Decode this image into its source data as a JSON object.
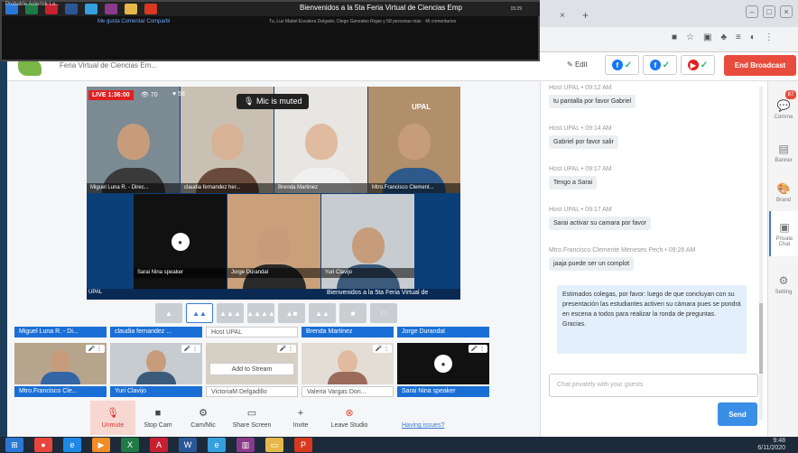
{
  "browser": {
    "tab_close": "×",
    "tab_new": "+",
    "win_controls": [
      "–",
      "□",
      "×"
    ],
    "addr_icons": [
      "■",
      "☆",
      "▣",
      "♣",
      "≡",
      "◐",
      "⋮"
    ]
  },
  "overlay": {
    "left_text": "Probable Asterisk La...",
    "title": "Bienvenidos a la 5ta Feria Virtual de Ciencias Emp",
    "actions": "Me gusta   Comentar   Compartir",
    "reactions_text": "Tu, Luz Mabel Escalera Delgado, Diego Gonzales Rojas y 58 personas más · 46 comentarios",
    "clock": "15:29"
  },
  "studio": {
    "title": "Feria Virtual de Ciencias Em...",
    "edit_label": "Edit",
    "destinations": [
      {
        "icon": "facebook-icon",
        "glyph": "f",
        "status": "✓"
      },
      {
        "icon": "facebook-icon",
        "glyph": "f",
        "status": "✓"
      },
      {
        "icon": "youtube-icon",
        "glyph": "▶",
        "status": "✓"
      }
    ],
    "end_label": "End Broadcast"
  },
  "stage": {
    "live_label": "LIVE 1:36:00",
    "viewers": "70",
    "reactions": "58",
    "mic_muted": "Mic is muted",
    "org_logo": "UPAL",
    "ticker_left": "UPAL",
    "ticker_text": "Bienvenidos a la 5ta Feria Virtual de",
    "tiles": [
      {
        "label": "Miguel Luna R. - Direc..."
      },
      {
        "label": "claudia fernandez her..."
      },
      {
        "label": "Brenda Martinez"
      },
      {
        "label": "Mtro.Francisco Clement..."
      },
      {
        "label": "Sarai Nina speaker"
      },
      {
        "label": "Jorge Durandal"
      },
      {
        "label": "Yuri Clavijo"
      }
    ]
  },
  "layouts": [
    "▲",
    "▲▲",
    "▲▲▲",
    "▲▲▲▲",
    "▲■",
    "▲▲",
    "■",
    "□"
  ],
  "backstage": {
    "top_row": [
      {
        "name": "Miguel Luna R. - Di...",
        "style": "solid"
      },
      {
        "name": "claudia fernandez ...",
        "style": "solid"
      },
      {
        "name": "Host UPAL",
        "style": "ghost"
      },
      {
        "name": "Brenda Martinez",
        "style": "solid"
      },
      {
        "name": "Jorge Durandal",
        "style": "solid"
      }
    ],
    "bottom_row": [
      {
        "name": "Mtro.Francisco Cle...",
        "style": "solid"
      },
      {
        "name": "Yuri Clavijo",
        "style": "solid"
      },
      {
        "name": "VictoriaM Delgadillo",
        "style": "ghost"
      },
      {
        "name": "Valeria Vargas Dori...",
        "style": "ghost"
      },
      {
        "name": "Sarai Nina speaker",
        "style": "solid"
      }
    ],
    "add_to_stream": "Add to Stream",
    "tools": "🎤 ⋮"
  },
  "controls": [
    {
      "icon": "mic-off-icon",
      "glyph": "🎙",
      "label": "Unmute"
    },
    {
      "icon": "camera-icon",
      "glyph": "■",
      "label": "Stop Cam"
    },
    {
      "icon": "gear-icon",
      "glyph": "⚙",
      "label": "Cam/Mic"
    },
    {
      "icon": "screen-icon",
      "glyph": "▭",
      "label": "Share Screen"
    },
    {
      "icon": "invite-icon",
      "glyph": "+",
      "label": "Invite"
    },
    {
      "icon": "leave-icon",
      "glyph": "⊗",
      "label": "Leave Studio"
    }
  ],
  "having_issues": "Having issues?",
  "chat": {
    "messages": [
      {
        "meta": "Host UPAL  •  09:12 AM",
        "text": "tu pantalla por favor Gabriel"
      },
      {
        "meta": "Host UPAL  •  09:14 AM",
        "text": "Gabriel por favor salir"
      },
      {
        "meta": "Host UPAL  •  09:17 AM",
        "text": "Tengo a Sarai"
      },
      {
        "meta": "Host UPAL  •  09:17 AM",
        "text": "Sarai activar su camara por favor"
      },
      {
        "meta": "Mtro.Francisco Clemente Meneses Pech  •  09:26 AM",
        "text": "jaaja puede ser un complot"
      }
    ],
    "info": "Estimados colegas, por favor: luego de que concluyan con su presentación las estudiantes activen su cámara pues se pondrá en escena a todos para realizar la ronda de preguntas. Gracias.",
    "placeholder": "Chat privately with your guests",
    "send_label": "Send"
  },
  "rightbar": [
    {
      "icon": "comments-icon",
      "glyph": "💬",
      "label": "Comme"
    },
    {
      "icon": "banner-icon",
      "glyph": "▤",
      "label": "Banner"
    },
    {
      "icon": "brand-icon",
      "glyph": "🎨",
      "label": "Brand"
    },
    {
      "icon": "private-chat-icon",
      "glyph": "▣",
      "label": "Private Chat"
    },
    {
      "icon": "settings-icon",
      "glyph": "⚙",
      "label": "Setting"
    }
  ],
  "rightbar_badge": "87",
  "taskbar": {
    "clock": "9:48",
    "date": "6/11/2020",
    "apps": [
      {
        "icon": "windows-icon",
        "glyph": "⊞",
        "color": "#2a78d6"
      },
      {
        "icon": "chrome-icon",
        "glyph": "●",
        "color": "#e8453c"
      },
      {
        "icon": "edge-icon",
        "glyph": "e",
        "color": "#1e88e5"
      },
      {
        "icon": "media-icon",
        "glyph": "▶",
        "color": "#f28c28"
      },
      {
        "icon": "excel-icon",
        "glyph": "X",
        "color": "#1f7a45"
      },
      {
        "icon": "acrobat-icon",
        "glyph": "A",
        "color": "#c8202f"
      },
      {
        "icon": "word-icon",
        "glyph": "W",
        "color": "#2b5797"
      },
      {
        "icon": "ie-icon",
        "glyph": "e",
        "color": "#35a0e0"
      },
      {
        "icon": "winrar-icon",
        "glyph": "▥",
        "color": "#8a3a8a"
      },
      {
        "icon": "folder-icon",
        "glyph": "▭",
        "color": "#e6b84a"
      },
      {
        "icon": "pdf-icon",
        "glyph": "P",
        "color": "#d8381f"
      }
    ]
  }
}
